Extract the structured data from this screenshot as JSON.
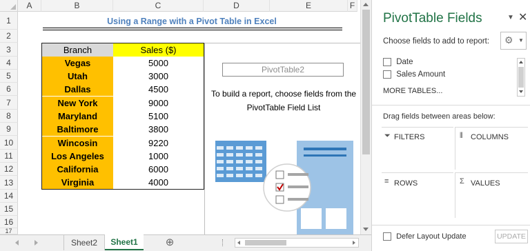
{
  "columns": [
    "A",
    "B",
    "C",
    "D",
    "E",
    "F"
  ],
  "rows": [
    "1",
    "2",
    "3",
    "4",
    "5",
    "6",
    "7",
    "8",
    "9",
    "10",
    "11",
    "12",
    "13",
    "14",
    "15",
    "16",
    "17"
  ],
  "title": "Using a Range with a Pivot Table in Excel",
  "table": {
    "headers": [
      "Branch",
      "Sales ($)"
    ],
    "rows": [
      {
        "branch": "Vegas",
        "sales": "5000"
      },
      {
        "branch": "Utah",
        "sales": "3000"
      },
      {
        "branch": "Dallas",
        "sales": "4500"
      },
      {
        "branch": "New York",
        "sales": "9000"
      },
      {
        "branch": "Maryland",
        "sales": "5100"
      },
      {
        "branch": "Baltimore",
        "sales": "3800"
      },
      {
        "branch": "Wincosin",
        "sales": "9220"
      },
      {
        "branch": "Los Angeles",
        "sales": "1000"
      },
      {
        "branch": "California",
        "sales": "6000"
      },
      {
        "branch": "Virginia",
        "sales": "4000"
      }
    ]
  },
  "pivot": {
    "name": "PivotTable2",
    "instructions": "To build a report, choose fields from the PivotTable Field List"
  },
  "sheets": {
    "tab1": "Sheet2",
    "tab2": "Sheet1",
    "add": "⊕"
  },
  "panel": {
    "title": "PivotTable Fields",
    "choose_label": "Choose fields to add to report:",
    "fields": [
      "Date",
      "Sales Amount"
    ],
    "more_tables": "MORE TABLES...",
    "drag_label": "Drag fields between areas below:",
    "areas": {
      "filters": "FILTERS",
      "columns": "COLUMNS",
      "rows": "ROWS",
      "values": "VALUES"
    },
    "defer": "Defer Layout Update",
    "update": "UPDATE"
  },
  "colors": {
    "accent_title": "#4f81bd",
    "branch_fill": "#ffc000",
    "sales_header_fill": "#ffff00",
    "panel_title": "#217346",
    "active_tab": "#217346"
  }
}
